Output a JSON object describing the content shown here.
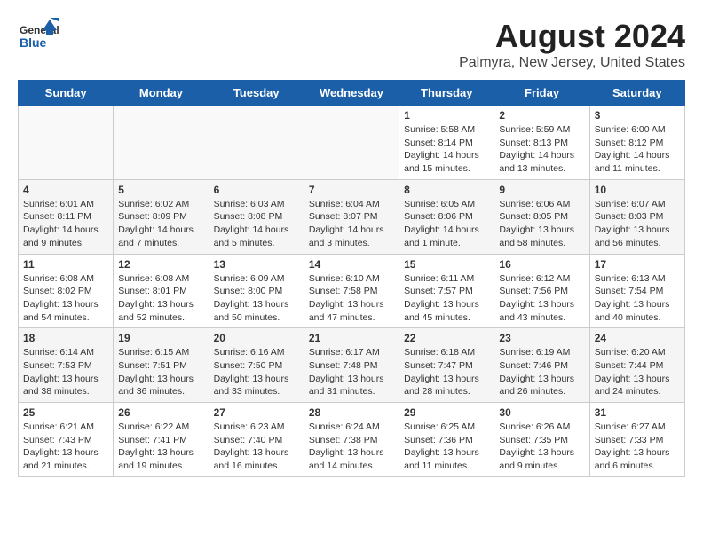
{
  "header": {
    "logo_general": "General",
    "logo_blue": "Blue",
    "title": "August 2024",
    "subtitle": "Palmyra, New Jersey, United States"
  },
  "weekdays": [
    "Sunday",
    "Monday",
    "Tuesday",
    "Wednesday",
    "Thursday",
    "Friday",
    "Saturday"
  ],
  "weeks": [
    [
      {
        "day": "",
        "empty": true
      },
      {
        "day": "",
        "empty": true
      },
      {
        "day": "",
        "empty": true
      },
      {
        "day": "",
        "empty": true
      },
      {
        "day": "1",
        "sunrise": "Sunrise: 5:58 AM",
        "sunset": "Sunset: 8:14 PM",
        "daylight": "Daylight: 14 hours and 15 minutes."
      },
      {
        "day": "2",
        "sunrise": "Sunrise: 5:59 AM",
        "sunset": "Sunset: 8:13 PM",
        "daylight": "Daylight: 14 hours and 13 minutes."
      },
      {
        "day": "3",
        "sunrise": "Sunrise: 6:00 AM",
        "sunset": "Sunset: 8:12 PM",
        "daylight": "Daylight: 14 hours and 11 minutes."
      }
    ],
    [
      {
        "day": "4",
        "sunrise": "Sunrise: 6:01 AM",
        "sunset": "Sunset: 8:11 PM",
        "daylight": "Daylight: 14 hours and 9 minutes."
      },
      {
        "day": "5",
        "sunrise": "Sunrise: 6:02 AM",
        "sunset": "Sunset: 8:09 PM",
        "daylight": "Daylight: 14 hours and 7 minutes."
      },
      {
        "day": "6",
        "sunrise": "Sunrise: 6:03 AM",
        "sunset": "Sunset: 8:08 PM",
        "daylight": "Daylight: 14 hours and 5 minutes."
      },
      {
        "day": "7",
        "sunrise": "Sunrise: 6:04 AM",
        "sunset": "Sunset: 8:07 PM",
        "daylight": "Daylight: 14 hours and 3 minutes."
      },
      {
        "day": "8",
        "sunrise": "Sunrise: 6:05 AM",
        "sunset": "Sunset: 8:06 PM",
        "daylight": "Daylight: 14 hours and 1 minute."
      },
      {
        "day": "9",
        "sunrise": "Sunrise: 6:06 AM",
        "sunset": "Sunset: 8:05 PM",
        "daylight": "Daylight: 13 hours and 58 minutes."
      },
      {
        "day": "10",
        "sunrise": "Sunrise: 6:07 AM",
        "sunset": "Sunset: 8:03 PM",
        "daylight": "Daylight: 13 hours and 56 minutes."
      }
    ],
    [
      {
        "day": "11",
        "sunrise": "Sunrise: 6:08 AM",
        "sunset": "Sunset: 8:02 PM",
        "daylight": "Daylight: 13 hours and 54 minutes."
      },
      {
        "day": "12",
        "sunrise": "Sunrise: 6:08 AM",
        "sunset": "Sunset: 8:01 PM",
        "daylight": "Daylight: 13 hours and 52 minutes."
      },
      {
        "day": "13",
        "sunrise": "Sunrise: 6:09 AM",
        "sunset": "Sunset: 8:00 PM",
        "daylight": "Daylight: 13 hours and 50 minutes."
      },
      {
        "day": "14",
        "sunrise": "Sunrise: 6:10 AM",
        "sunset": "Sunset: 7:58 PM",
        "daylight": "Daylight: 13 hours and 47 minutes."
      },
      {
        "day": "15",
        "sunrise": "Sunrise: 6:11 AM",
        "sunset": "Sunset: 7:57 PM",
        "daylight": "Daylight: 13 hours and 45 minutes."
      },
      {
        "day": "16",
        "sunrise": "Sunrise: 6:12 AM",
        "sunset": "Sunset: 7:56 PM",
        "daylight": "Daylight: 13 hours and 43 minutes."
      },
      {
        "day": "17",
        "sunrise": "Sunrise: 6:13 AM",
        "sunset": "Sunset: 7:54 PM",
        "daylight": "Daylight: 13 hours and 40 minutes."
      }
    ],
    [
      {
        "day": "18",
        "sunrise": "Sunrise: 6:14 AM",
        "sunset": "Sunset: 7:53 PM",
        "daylight": "Daylight: 13 hours and 38 minutes."
      },
      {
        "day": "19",
        "sunrise": "Sunrise: 6:15 AM",
        "sunset": "Sunset: 7:51 PM",
        "daylight": "Daylight: 13 hours and 36 minutes."
      },
      {
        "day": "20",
        "sunrise": "Sunrise: 6:16 AM",
        "sunset": "Sunset: 7:50 PM",
        "daylight": "Daylight: 13 hours and 33 minutes."
      },
      {
        "day": "21",
        "sunrise": "Sunrise: 6:17 AM",
        "sunset": "Sunset: 7:48 PM",
        "daylight": "Daylight: 13 hours and 31 minutes."
      },
      {
        "day": "22",
        "sunrise": "Sunrise: 6:18 AM",
        "sunset": "Sunset: 7:47 PM",
        "daylight": "Daylight: 13 hours and 28 minutes."
      },
      {
        "day": "23",
        "sunrise": "Sunrise: 6:19 AM",
        "sunset": "Sunset: 7:46 PM",
        "daylight": "Daylight: 13 hours and 26 minutes."
      },
      {
        "day": "24",
        "sunrise": "Sunrise: 6:20 AM",
        "sunset": "Sunset: 7:44 PM",
        "daylight": "Daylight: 13 hours and 24 minutes."
      }
    ],
    [
      {
        "day": "25",
        "sunrise": "Sunrise: 6:21 AM",
        "sunset": "Sunset: 7:43 PM",
        "daylight": "Daylight: 13 hours and 21 minutes."
      },
      {
        "day": "26",
        "sunrise": "Sunrise: 6:22 AM",
        "sunset": "Sunset: 7:41 PM",
        "daylight": "Daylight: 13 hours and 19 minutes."
      },
      {
        "day": "27",
        "sunrise": "Sunrise: 6:23 AM",
        "sunset": "Sunset: 7:40 PM",
        "daylight": "Daylight: 13 hours and 16 minutes."
      },
      {
        "day": "28",
        "sunrise": "Sunrise: 6:24 AM",
        "sunset": "Sunset: 7:38 PM",
        "daylight": "Daylight: 13 hours and 14 minutes."
      },
      {
        "day": "29",
        "sunrise": "Sunrise: 6:25 AM",
        "sunset": "Sunset: 7:36 PM",
        "daylight": "Daylight: 13 hours and 11 minutes."
      },
      {
        "day": "30",
        "sunrise": "Sunrise: 6:26 AM",
        "sunset": "Sunset: 7:35 PM",
        "daylight": "Daylight: 13 hours and 9 minutes."
      },
      {
        "day": "31",
        "sunrise": "Sunrise: 6:27 AM",
        "sunset": "Sunset: 7:33 PM",
        "daylight": "Daylight: 13 hours and 6 minutes."
      }
    ]
  ]
}
